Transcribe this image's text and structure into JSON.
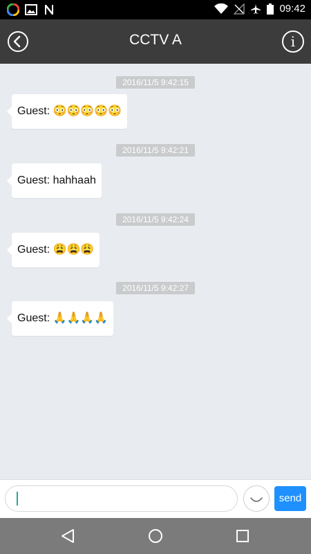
{
  "status_bar": {
    "time": "09:42"
  },
  "app_bar": {
    "title": "CCTV A"
  },
  "messages": [
    {
      "timestamp": "2016/11/5 9:42:15",
      "text": "Guest: 😳😳😳😳😳"
    },
    {
      "timestamp": "2016/11/5 9:42:21",
      "text": "Guest: hahhaah"
    },
    {
      "timestamp": "2016/11/5 9:42:24",
      "text": "Guest: 😩😩😩"
    },
    {
      "timestamp": "2016/11/5 9:42:27",
      "text": "Guest: 🙏🙏🙏🙏"
    }
  ],
  "input": {
    "value": "",
    "send_label": "send"
  },
  "colors": {
    "app_bar": "#3c3c3c",
    "send": "#1e90ff",
    "background": "#e8ecf0"
  },
  "icons": {
    "back": "back-chevron-circle",
    "info": "info-circle",
    "emoji": "smiley-face",
    "nav_back": "triangle-back",
    "nav_home": "circle-home",
    "nav_recent": "square-recent"
  }
}
